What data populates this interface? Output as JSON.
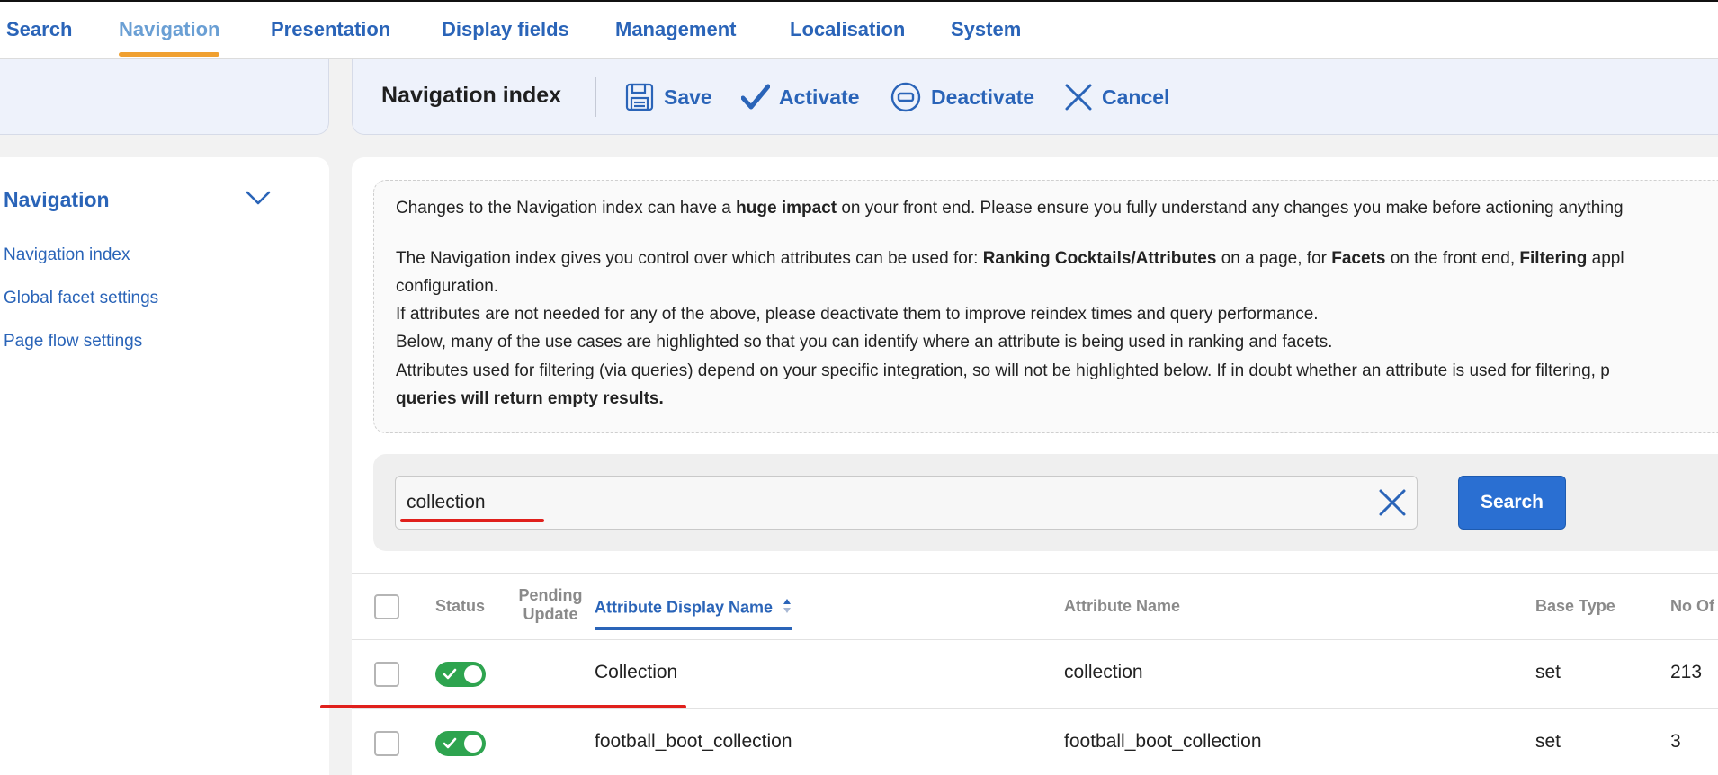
{
  "topnav": {
    "tabs": [
      {
        "label": "Search"
      },
      {
        "label": "Navigation"
      },
      {
        "label": "Presentation"
      },
      {
        "label": "Display fields"
      },
      {
        "label": "Management"
      },
      {
        "label": "Localisation"
      },
      {
        "label": "System"
      }
    ],
    "active": "Navigation"
  },
  "toolbar": {
    "title": "Navigation index",
    "save": "Save",
    "activate": "Activate",
    "deactivate": "Deactivate",
    "cancel": "Cancel"
  },
  "sidebar": {
    "heading": "Navigation",
    "items": [
      "Navigation index",
      "Global facet settings",
      "Page flow settings"
    ]
  },
  "info": {
    "line1_pre": "Changes to the Navigation index can have a ",
    "line1_bold": "huge impact",
    "line1_post": " on your front end. Please ensure you fully understand any changes you make before actioning anything",
    "line2_pre": "The Navigation index gives you control over which attributes can be used for: ",
    "line2_b1": "Ranking Cocktails/Attributes",
    "line2_mid1": " on a page, for ",
    "line2_b2": "Facets",
    "line2_mid2": " on the front end, ",
    "line2_b3": "Filtering",
    "line2_post": " appl",
    "line3": "configuration.",
    "line4": "If attributes are not needed for any of the above, please deactivate them to improve reindex times and query performance.",
    "line5": "Below, many of the use cases are highlighted so that you can identify where an attribute is being used in ranking and facets.",
    "line6": "Attributes used for filtering (via queries) depend on your specific integration, so will not be highlighted below. If in doubt whether an attribute is used for filtering, p",
    "line7_bold": "queries will return empty results."
  },
  "search": {
    "value": "collection",
    "button": "Search"
  },
  "table": {
    "headers": {
      "status": "Status",
      "pending_line1": "Pending",
      "pending_line2": "Update",
      "display_name": "Attribute Display Name",
      "attr_name": "Attribute Name",
      "base_type": "Base Type",
      "no_of": "No Of"
    },
    "rows": [
      {
        "display_name": "Collection",
        "attr_name": "collection",
        "base_type": "set",
        "count": "213"
      },
      {
        "display_name": "football_boot_collection",
        "attr_name": "football_boot_collection",
        "base_type": "set",
        "count": "3"
      }
    ]
  },
  "colors": {
    "accent": "#2a64b8",
    "active_tab_underline": "#f0a030",
    "toggle_on": "#2ea44f",
    "annotation_red": "#e0201c",
    "search_button": "#2a6fd2"
  }
}
